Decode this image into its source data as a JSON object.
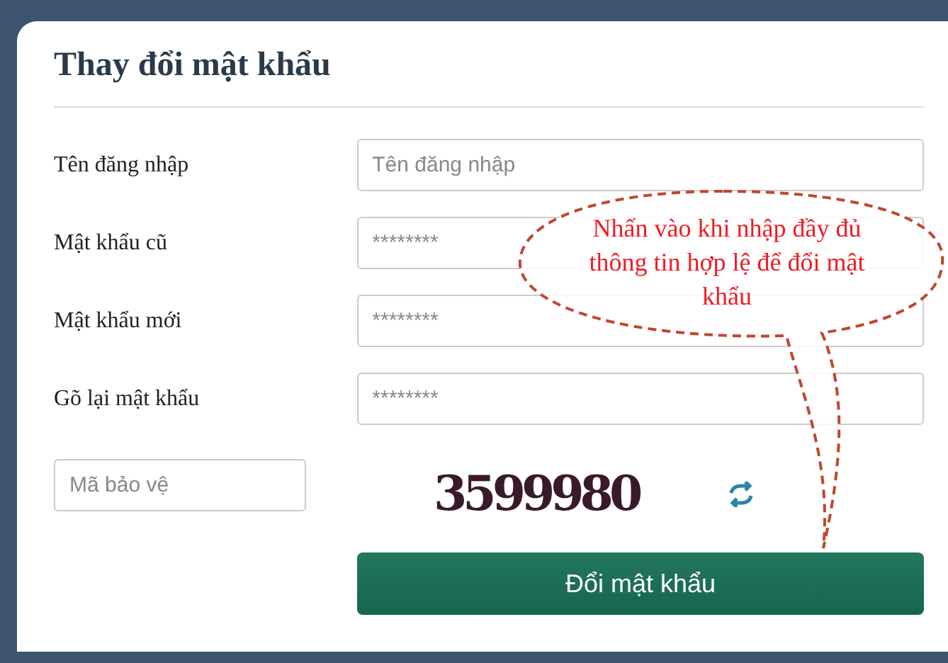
{
  "title": "Thay đổi mật khẩu",
  "fields": [
    {
      "label": "Tên đăng nhập",
      "placeholder": "Tên đăng nhập"
    },
    {
      "label": "Mật khẩu cũ",
      "placeholder": "********"
    },
    {
      "label": "Mật khẩu mới",
      "placeholder": "********"
    },
    {
      "label": "Gõ lại mật khẩu",
      "placeholder": "********"
    }
  ],
  "captcha": {
    "placeholder": "Mã bảo vệ",
    "code": "3599980"
  },
  "submit": "Đổi mật khẩu",
  "callout": "Nhấn vào khi nhập đầy đủ thông tin hợp lệ để đổi mật khẩu"
}
